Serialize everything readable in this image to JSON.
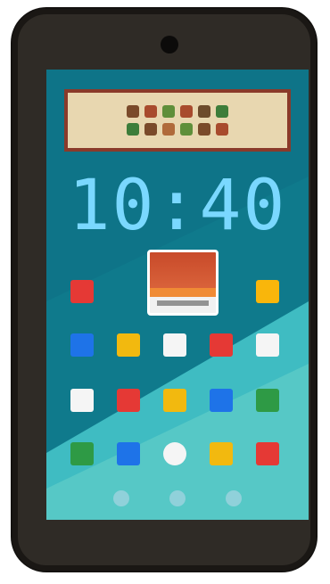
{
  "status": {
    "time": "10:40"
  },
  "colors": {
    "screen_bg": "#0f7a8c",
    "clock": "#7ad8ff",
    "banner_bg": "#e8d7b0",
    "banner_border": "#8a3a2a"
  },
  "banner": {
    "icon": "pixel-art-banner-icon"
  },
  "widget": {
    "icon": "calendar-widget-icon"
  },
  "home_apps": [
    {
      "name": "app-red-1",
      "color": "#e53935",
      "row": 0,
      "col": 0
    },
    {
      "name": "app-yellow-1",
      "color": "#f9b60b",
      "row": 0,
      "col": 4
    },
    {
      "name": "app-blue-1",
      "color": "#1e73e8",
      "row": 1,
      "col": 0
    },
    {
      "name": "app-yellow-2",
      "color": "#f2b90f",
      "row": 1,
      "col": 1
    },
    {
      "name": "app-white-1",
      "color": "#f5f5f5",
      "row": 1,
      "col": 2
    },
    {
      "name": "app-red-2",
      "color": "#e53935",
      "row": 1,
      "col": 3
    },
    {
      "name": "app-white-2",
      "color": "#f5f5f5",
      "row": 1,
      "col": 4
    },
    {
      "name": "app-white-3",
      "color": "#f5f5f5",
      "row": 2,
      "col": 0
    },
    {
      "name": "app-red-3",
      "color": "#e53935",
      "row": 2,
      "col": 1
    },
    {
      "name": "app-yellow-3",
      "color": "#f2b90f",
      "row": 2,
      "col": 2
    },
    {
      "name": "app-blue-2",
      "color": "#1e73e8",
      "row": 2,
      "col": 3
    },
    {
      "name": "app-green-1",
      "color": "#2e9a45",
      "row": 2,
      "col": 4
    }
  ],
  "dock_apps": [
    {
      "name": "dock-app-green",
      "color": "#2e9a45"
    },
    {
      "name": "dock-app-blue",
      "color": "#1e73e8"
    },
    {
      "name": "dock-app-white",
      "color": "#f5f5f5"
    },
    {
      "name": "dock-app-yellow",
      "color": "#f2b90f"
    },
    {
      "name": "dock-app-red",
      "color": "#e53935"
    }
  ],
  "nav": [
    "nav-back",
    "nav-home",
    "nav-recents"
  ]
}
